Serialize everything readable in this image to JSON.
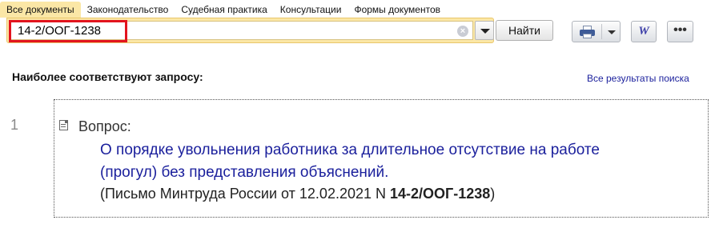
{
  "tabs": [
    {
      "label": "Все документы",
      "active": true
    },
    {
      "label": "Законодательство",
      "active": false
    },
    {
      "label": "Судебная практика",
      "active": false
    },
    {
      "label": "Консультации",
      "active": false
    },
    {
      "label": "Формы документов",
      "active": false
    }
  ],
  "search": {
    "value": "14-2/ООГ-1238",
    "find_label": "Найти"
  },
  "toolbar": {
    "print_icon": "printer-icon",
    "word_icon": "word-export-icon",
    "word_label": "W",
    "more_icon": "more-options-icon",
    "more_label": "•••"
  },
  "results": {
    "title": "Наиболее соответствуют запросу:",
    "all_link": "Все результаты поиска",
    "items": [
      {
        "number": "1",
        "label": "Вопрос:",
        "link_text": "О порядке увольнения работника за длительное отсутствие на работе (прогул) без представления объяснений.",
        "ref_prefix": "(Письмо Минтруда России от 12.02.2021 N ",
        "ref_bold": "14-2/ООГ-1238",
        "ref_suffix": ")"
      }
    ]
  },
  "colors": {
    "tab_active_bg": "#fbe7a6",
    "link": "#1a1f9c",
    "highlight": "#e2141e"
  }
}
